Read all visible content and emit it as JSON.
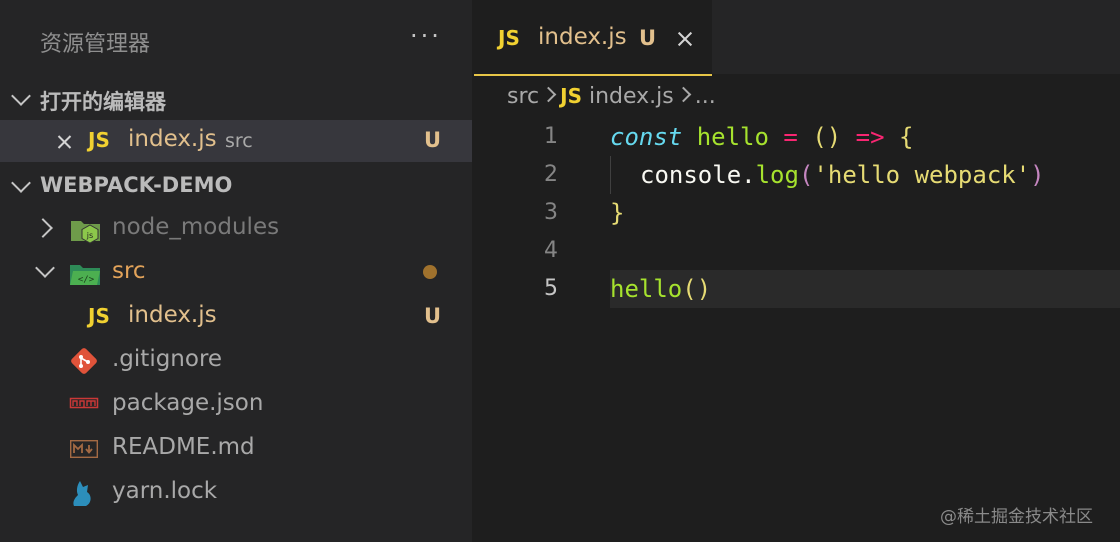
{
  "sidebar": {
    "title": "资源管理器",
    "more": "···",
    "open_editors": {
      "label": "打开的编辑器",
      "items": [
        {
          "icon": "JS",
          "name": "index.js",
          "folder": "src",
          "badge": "U"
        }
      ]
    },
    "project": {
      "label": "WEBPACK-DEMO",
      "items": [
        {
          "name": "node_modules",
          "icon": "node-folder-icon"
        },
        {
          "name": "src",
          "icon": "src-folder-icon"
        },
        {
          "name": "index.js",
          "icon": "JS",
          "badge": "U"
        },
        {
          "name": ".gitignore",
          "icon": "git-icon"
        },
        {
          "name": "package.json",
          "icon": "npm-icon"
        },
        {
          "name": "README.md",
          "icon": "markdown-icon"
        },
        {
          "name": "yarn.lock",
          "icon": "yarn-icon"
        }
      ]
    }
  },
  "editor": {
    "tab": {
      "icon": "JS",
      "name": "index.js",
      "badge": "U"
    },
    "breadcrumb": {
      "folder": "src",
      "icon": "JS",
      "file": "index.js",
      "more": "..."
    },
    "line_numbers": [
      "1",
      "2",
      "3",
      "4",
      "5"
    ],
    "code": {
      "l1": {
        "kw": "const",
        "name": "hello",
        "eq": "=",
        "paren": "()",
        "arrow": "=>",
        "brace": "{"
      },
      "l2": {
        "obj": "console",
        "dot": ".",
        "method": "log",
        "open": "(",
        "str": "'hello webpack'",
        "close": ")"
      },
      "l3": {
        "brace": "}"
      },
      "l5": {
        "call": "hello",
        "paren": "()"
      }
    }
  },
  "watermark": "@稀土掘金技术社区",
  "colors": {
    "accent": "#e7c547",
    "js": "#f1d131",
    "modified": "#e2c08d",
    "untracked_folder": "#a0722d"
  }
}
